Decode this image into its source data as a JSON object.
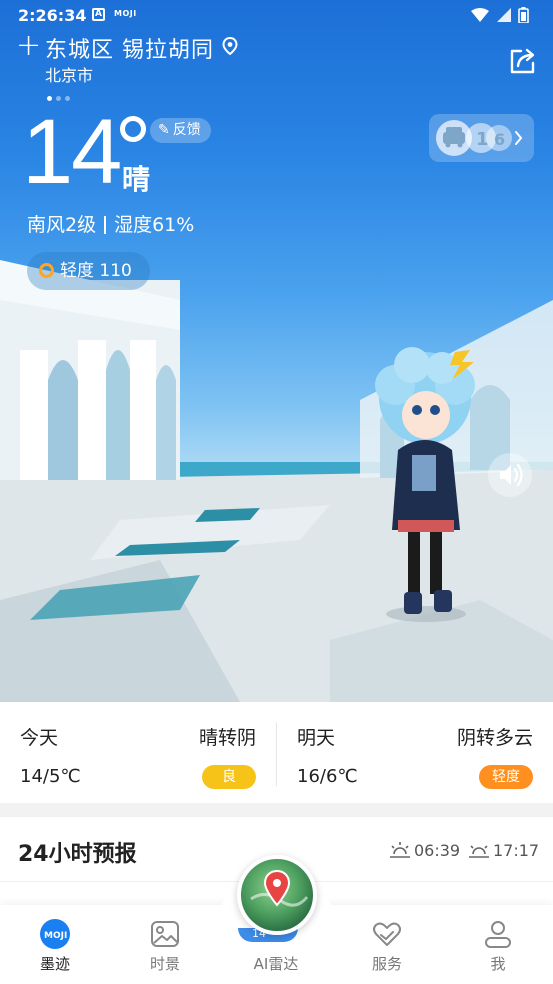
{
  "status_bar": {
    "time": "2:26:34",
    "app_icons": [
      "a-icon",
      "moji-icon"
    ],
    "moji_text": "MOJI"
  },
  "location": {
    "district": "东城区 锡拉胡同",
    "city": "北京市",
    "page_count": 3,
    "active_page": 1
  },
  "current": {
    "temperature": "14",
    "condition": "晴",
    "feedback_label": "反馈",
    "wind": "南风2级",
    "humidity": "湿度61%"
  },
  "air_quality": {
    "label": "轻度 110",
    "color": "#ffa51f"
  },
  "daily": [
    {
      "day": "今天",
      "condition": "晴转阴",
      "range": "14/5℃",
      "aqi": "良",
      "aqi_color": "#f6c419"
    },
    {
      "day": "明天",
      "condition": "阴转多云",
      "range": "16/6℃",
      "aqi": "轻度",
      "aqi_color": "#ff8f1f"
    }
  ],
  "hourly": {
    "title": "24小时预报",
    "sunrise": "06:39",
    "sunset": "17:17"
  },
  "nav": {
    "items": [
      {
        "label": "墨迹",
        "icon": "moji-logo-icon",
        "active": true
      },
      {
        "label": "时景",
        "icon": "photo-icon",
        "active": false
      },
      {
        "label": "AI雷达",
        "icon": "radar-globe-icon",
        "active": false
      },
      {
        "label": "服务",
        "icon": "heart-hands-icon",
        "active": false
      },
      {
        "label": "我",
        "icon": "user-icon",
        "active": false
      }
    ],
    "radar_badge": "14"
  },
  "colors": {
    "accent": "#1a7ff0",
    "hero_sky": "#2a85e4"
  }
}
